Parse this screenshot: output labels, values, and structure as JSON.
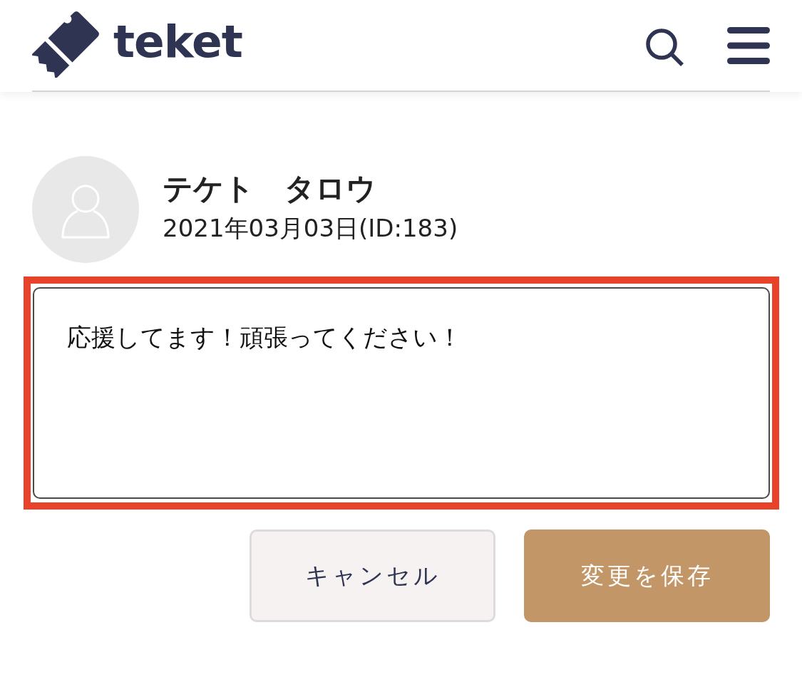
{
  "header": {
    "logo_text": "teket"
  },
  "user": {
    "name": "テケト　タロウ",
    "meta": "2021年03月03日(ID:183)"
  },
  "comment": {
    "value": "応援してます！頑張ってください！",
    "highlighted": true
  },
  "buttons": [
    {
      "label": "キャンセル",
      "kind": "secondary"
    },
    {
      "label": "変更を保存",
      "kind": "primary"
    }
  ]
}
